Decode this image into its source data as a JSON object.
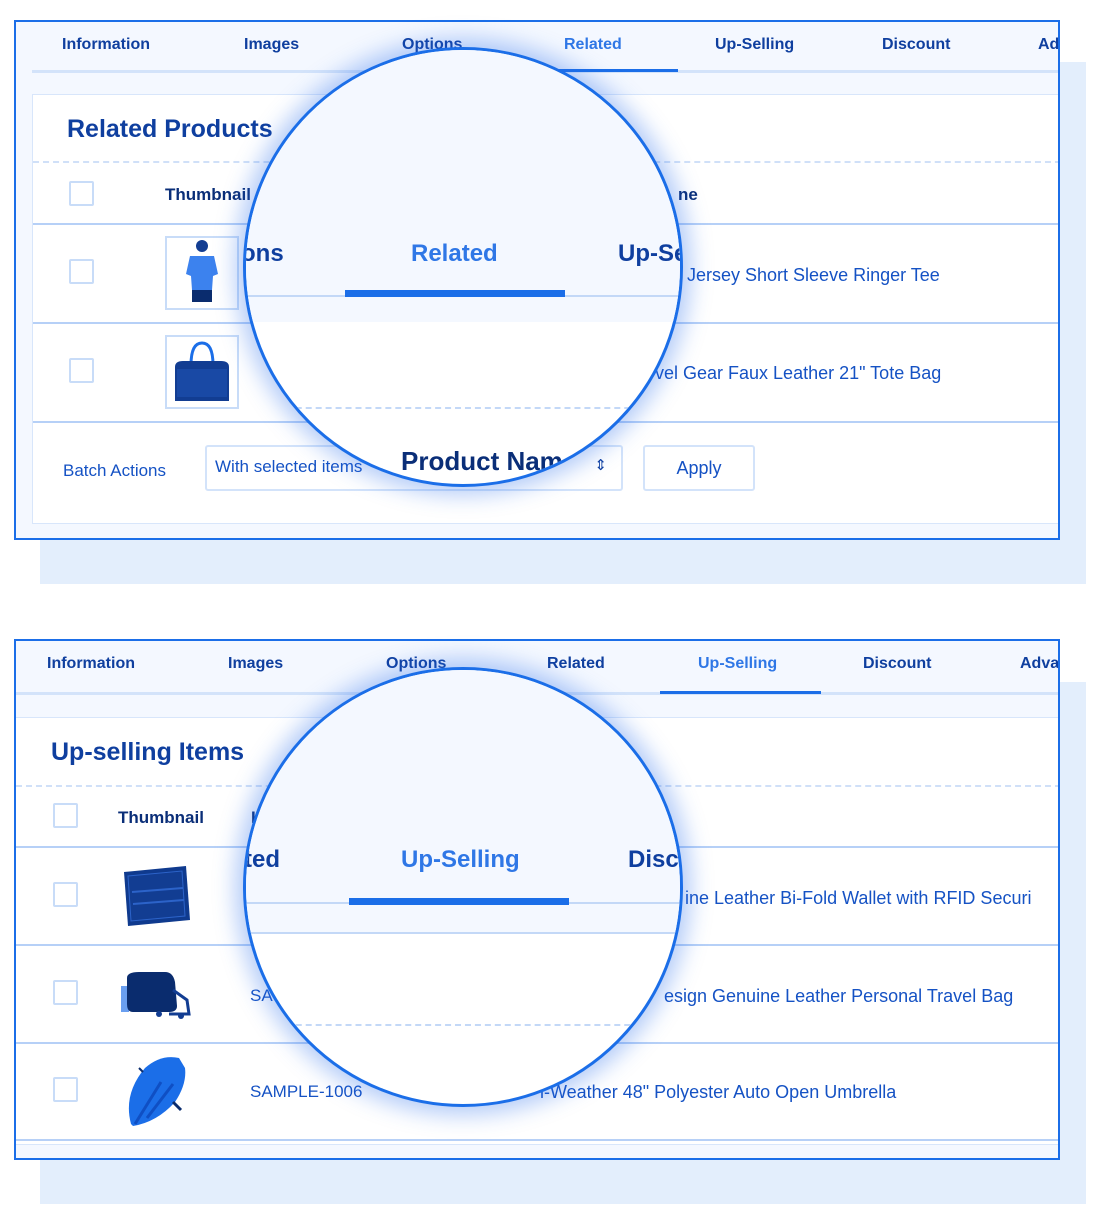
{
  "colors": {
    "accent": "#1b6ee8",
    "text_dark": "#0f3f9f",
    "text_link": "#1552c4",
    "active_tab": "#2f77e6",
    "shadow_bg": "#e3eefc"
  },
  "panel_related": {
    "tabs": [
      {
        "label": "Information",
        "active": false
      },
      {
        "label": "Images",
        "active": false
      },
      {
        "label": "Options",
        "active": false
      },
      {
        "label": "Related",
        "active": true
      },
      {
        "label": "Up-Selling",
        "active": false
      },
      {
        "label": "Discount",
        "active": false
      },
      {
        "label": "Ad",
        "active": false
      }
    ],
    "title": "Related Products",
    "columns": {
      "thumbnail": "Thumbnail",
      "name_fragment": "ne"
    },
    "rows": [
      {
        "thumbnail_icon": "tshirt-model-icon",
        "name": "Jersey Short Sleeve Ringer Tee"
      },
      {
        "thumbnail_icon": "tote-bag-icon",
        "name": "vel Gear Faux Leather 21\" Tote Bag"
      }
    ],
    "batch": {
      "label": "Batch Actions",
      "select_value": "With selected items",
      "apply_label": "Apply"
    },
    "lens": {
      "tabs": [
        {
          "label": "ons",
          "active": false
        },
        {
          "label": "Related",
          "active": true
        },
        {
          "label": "Up-Se",
          "active": false
        }
      ],
      "column_header": "Product Nam"
    }
  },
  "panel_upselling": {
    "tabs": [
      {
        "label": "Information",
        "active": false
      },
      {
        "label": "Images",
        "active": false
      },
      {
        "label": "Options",
        "active": false
      },
      {
        "label": "Related",
        "active": false
      },
      {
        "label": "Up-Selling",
        "active": true
      },
      {
        "label": "Discount",
        "active": false
      },
      {
        "label": "Adva",
        "active": false
      }
    ],
    "title": "Up-selling Items",
    "columns": {
      "thumbnail": "Thumbnail",
      "sku_fragment": "I"
    },
    "rows": [
      {
        "thumbnail_icon": "wallet-icon",
        "sku": "",
        "name": "ine Leather Bi-Fold Wallet with RFID Securi"
      },
      {
        "thumbnail_icon": "travel-bag-icon",
        "sku": "SA",
        "name": "esign Genuine Leather Personal Travel Bag"
      },
      {
        "thumbnail_icon": "umbrella-icon",
        "sku": "SAMPLE-1006",
        "name": "l-Weather 48\" Polyester Auto Open Umbrella"
      }
    ],
    "lens": {
      "tabs": [
        {
          "label": "ted",
          "active": false
        },
        {
          "label": "Up-Selling",
          "active": true
        },
        {
          "label": "Disco",
          "active": false
        }
      ]
    }
  }
}
